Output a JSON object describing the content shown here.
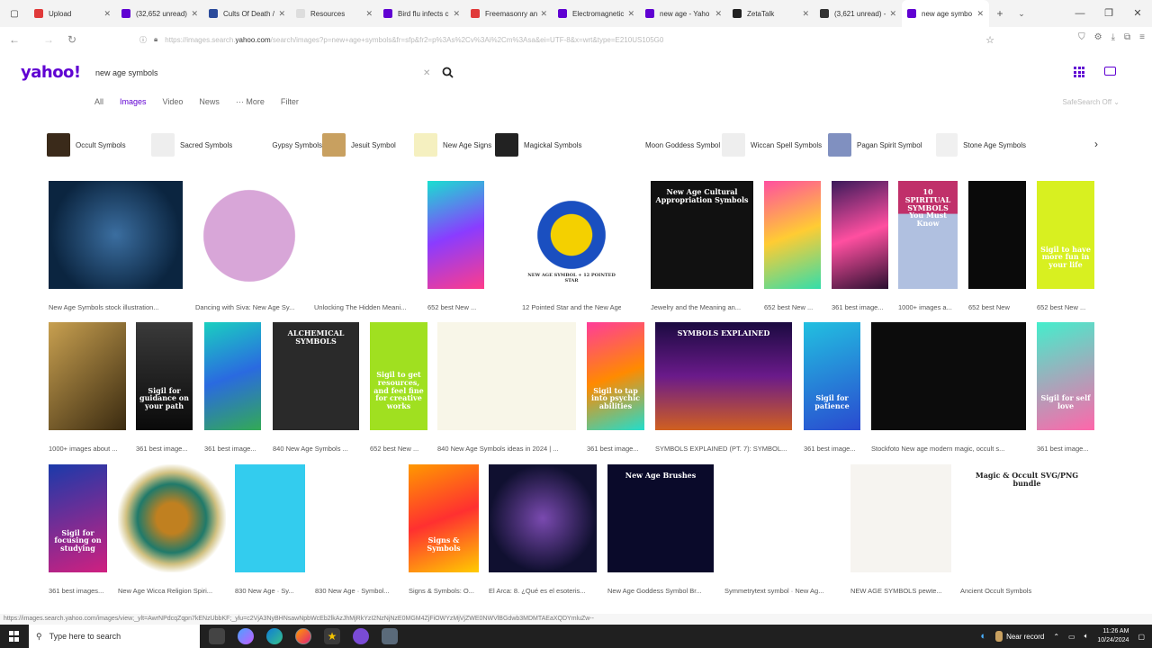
{
  "tabs": [
    {
      "title": "Upload",
      "color": "#e03a3a"
    },
    {
      "title": "(32,652 unread) ·",
      "color": "#6001d2"
    },
    {
      "title": "Cults Of Death /",
      "color": "#2b4b9b"
    },
    {
      "title": "Resources",
      "color": "#dddddd"
    },
    {
      "title": "Bird flu infects c",
      "color": "#6001d2"
    },
    {
      "title": "Freemasonry an",
      "color": "#e03a3a"
    },
    {
      "title": "Electromagnetic",
      "color": "#6001d2"
    },
    {
      "title": "new age - Yaho",
      "color": "#6001d2"
    },
    {
      "title": "ZetaTalk",
      "color": "#222222"
    },
    {
      "title": "(3,621 unread) -",
      "color": "#333333"
    },
    {
      "title": "new age symbo",
      "color": "#6001d2"
    }
  ],
  "address": {
    "url_prefix": "https://images.search.",
    "url_domain": "yahoo.com",
    "url_rest": "/search/images?p=new+age+symbols&fr=sfp&fr2=p%3As%2Cv%3Ai%2Cm%3Asa&ei=UTF-8&x=wrt&type=E210US105G0"
  },
  "logo": "yahoo!",
  "search": {
    "query": "new age symbols"
  },
  "filters": [
    "All",
    "Images",
    "Video",
    "News",
    "··· More",
    "Filter"
  ],
  "safesearch": "SafeSearch Off",
  "chips": [
    {
      "label": "Occult Symbols",
      "color": "#3a2a1a"
    },
    {
      "label": "Sacred Symbols",
      "color": "#eeeeee"
    },
    {
      "label": "Gypsy Symbols",
      "color": "#ffffff"
    },
    {
      "label": "Jesuit Symbol",
      "color": "#c8a060"
    },
    {
      "label": "New Age Signs",
      "color": "#f5f0c0"
    },
    {
      "label": "Magickal Symbols",
      "color": "#222222"
    },
    {
      "label": "Moon Goddess Symbol",
      "color": "#ffffff"
    },
    {
      "label": "Wiccan Spell Symbols",
      "color": "#eeeeee"
    },
    {
      "label": "Pagan Spirit Symbol",
      "color": "#8090c0"
    },
    {
      "label": "Stone Age Symbols",
      "color": "#f0f0f0"
    }
  ],
  "captions": [
    "New Age Symbols stock illustration...",
    "Dancing with Siva: New Age Sy...",
    "Unlocking The Hidden Meani...",
    "652 best New ...",
    "12 Pointed Star and the New Age Symbol",
    "Jewelry and the Meaning an...",
    "652 best New ...",
    "361 best image...",
    "1000+ images a...",
    "652 best New",
    "652 best New ...",
    "1000+ images about ...",
    "361 best image...",
    "361 best image...",
    "840 New Age  Symbols ...",
    "652 best New ...",
    "840 New Age  Symbols ideas in 2024 | ...",
    "361 best image...",
    "SYMBOLS EXPLAINED (PT. 7): SYMBOL...",
    "361 best image...",
    "Stockfoto New age modern magic, occult s...",
    "361 best image...",
    "361 best images...",
    "New Age Wicca Religion Spiri...",
    "830 New Age · Sy...",
    "830 New Age · Symbol...",
    "Signs & Symbols: O...",
    "El Arca: 8. ¿Qué es el esoteris...",
    "New Age Goddess Symbol Br...",
    "Symmetrytext symbol · New Ag...",
    "NEW AGE SYMBOLS pewte...",
    "Ancient Occult Symbols"
  ],
  "image_texts": {
    "sigil_guidance": "Sigil for guidance on your path",
    "sigil_creative": "Sigil to get resources, and feel fine for creative works",
    "sigil_patience": "Sigil for patience",
    "sigil_self_love": "Sigil for self love",
    "sigil_focusing": "Sigil for focusing on studying",
    "sigil_more_fun": "Sigil to have more fun in your life",
    "sigil_psychic": "Sigil to tap into psychic abilities",
    "symbols_explained": "SYMBOLS EXPLAINED",
    "symbols_explained_sub": "SYMBOLS 8 (PT. 7) OF THE NEW AGE AND OCCULT",
    "new_age_cultural": "New Age Cultural Appropriation Symbols",
    "spiritual_symbols": "10 SPIRITUAL SYMBOLS You Must Know",
    "signs_symbols": "Signs & Symbols",
    "new_age_brushes": "New Age Brushes",
    "occult_bundle": "Magic & Occult SVG/PNG bundle",
    "twelve_pointed": "NEW AGE SYMBOL + 12 POINTED STAR",
    "alchemical": "ALCHEMICAL SYMBOLS"
  },
  "status_url": "https://images.search.yahoo.com/images/view;_ylt=AwrNPdcqZqpn7kENzUbbKF;_ylu=c2VjA3NyBHNsawNpbWcEb2lkAzJhMjRkYzI2NzNjNzE0MGM4ZjFiOWYzMjVjZWE0NWVlBGdwb3MDMTAEaXQDYmluZw--",
  "taskbar": {
    "search_placeholder": "Type here to search",
    "recording": "Near record",
    "time": "11:26 AM",
    "date": "10/24/2024"
  }
}
